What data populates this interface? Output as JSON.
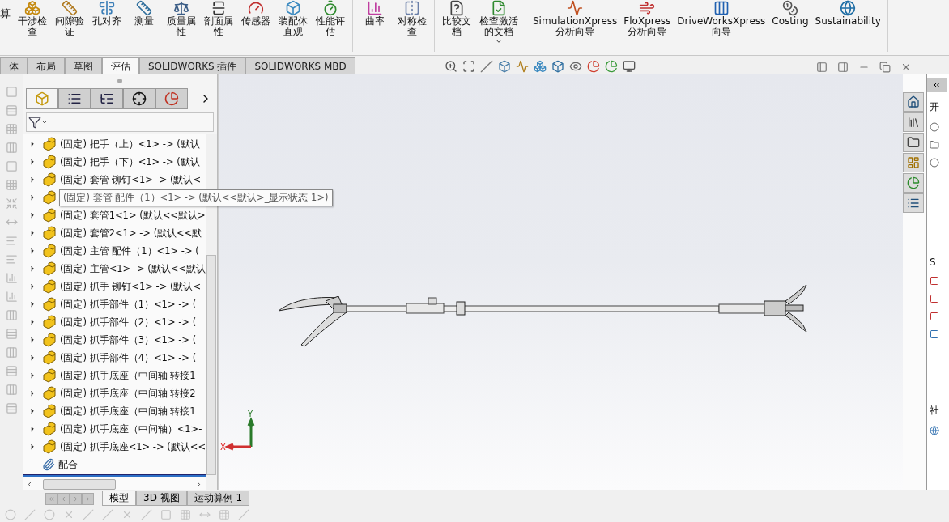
{
  "ribbon": {
    "cut_label": "算",
    "groups": [
      {
        "items": [
          {
            "label": "干涉检查"
          },
          {
            "label": "间隙验证"
          },
          {
            "label": "孔对齐"
          },
          {
            "label": "测量"
          },
          {
            "label": "质量属性"
          },
          {
            "label": "剖面属性"
          },
          {
            "label": "传感器"
          },
          {
            "label": "装配体直观"
          },
          {
            "label": "性能评估"
          }
        ]
      },
      {
        "items": [
          {
            "label": "曲率"
          },
          {
            "label": "对称检查"
          }
        ]
      },
      {
        "items": [
          {
            "label": "比较文档"
          },
          {
            "label": "检查激活的文档",
            "dropdown": true
          }
        ]
      },
      {
        "items": [
          {
            "label": "SimulationXpress\n分析向导"
          },
          {
            "label": "FloXpress\n分析向导"
          },
          {
            "label": "DriveWorksXpress\n向导"
          },
          {
            "label": "Costing"
          },
          {
            "label": "Sustainability"
          }
        ]
      }
    ]
  },
  "command_tabs": [
    {
      "label": "体",
      "selected": false
    },
    {
      "label": "布局",
      "selected": false
    },
    {
      "label": "草图",
      "selected": false
    },
    {
      "label": "评估",
      "selected": true
    },
    {
      "label": "SOLIDWORKS 插件",
      "selected": false
    },
    {
      "label": "SOLIDWORKS MBD",
      "selected": false
    }
  ],
  "feature_tree": {
    "items": [
      {
        "kind": "part",
        "label": "(固定) 把手（上）<1> -> (默认",
        "expanded": false
      },
      {
        "kind": "part",
        "label": "(固定) 把手（下）<1> -> (默认",
        "expanded": false
      },
      {
        "kind": "part",
        "label": "(固定) 套管  铆钉<1> -> (默认<",
        "expanded": false
      },
      {
        "kind": "part",
        "tooltip": "(固定) 套管  配件（1）<1> -> (默认<<默认>_显示状态 1>)",
        "expanded": false
      },
      {
        "kind": "part",
        "label": "(固定) 套管1<1> (默认<<默认>",
        "expanded": false
      },
      {
        "kind": "part",
        "label": "(固定) 套管2<1> -> (默认<<默",
        "expanded": false
      },
      {
        "kind": "part",
        "label": "(固定) 主管  配件（1）<1> -> (",
        "expanded": false
      },
      {
        "kind": "part",
        "label": "(固定) 主管<1> -> (默认<<默认",
        "expanded": false
      },
      {
        "kind": "part",
        "label": "(固定) 抓手  铆钉<1> -> (默认<",
        "expanded": false
      },
      {
        "kind": "part",
        "label": "(固定) 抓手部件（1）<1> -> (",
        "expanded": false
      },
      {
        "kind": "part",
        "label": "(固定) 抓手部件（2）<1> -> (",
        "expanded": false
      },
      {
        "kind": "part",
        "label": "(固定) 抓手部件（3）<1> -> (",
        "expanded": false
      },
      {
        "kind": "part",
        "label": "(固定) 抓手部件（4）<1> -> (",
        "expanded": false
      },
      {
        "kind": "part",
        "label": "(固定) 抓手底座（中间轴  转接1",
        "expanded": false
      },
      {
        "kind": "part",
        "label": "(固定) 抓手底座（中间轴  转接2",
        "expanded": false
      },
      {
        "kind": "part",
        "label": "(固定) 抓手底座（中间轴 转接1",
        "expanded": false
      },
      {
        "kind": "part",
        "label": "(固定) 抓手底座（中间轴）<1>-",
        "expanded": false
      },
      {
        "kind": "part",
        "label": "(固定) 抓手底座<1> -> (默认<<",
        "expanded": false
      },
      {
        "kind": "mates",
        "label": "配合"
      }
    ]
  },
  "triad": {
    "x": "X",
    "y": "Y"
  },
  "task_pane": {
    "texts": [
      "开",
      "S",
      "社"
    ]
  },
  "bottom_tabs": [
    {
      "label": "模型",
      "selected": true
    },
    {
      "label": "3D 视图",
      "selected": false
    },
    {
      "label": "运动算例 1",
      "selected": false
    }
  ]
}
